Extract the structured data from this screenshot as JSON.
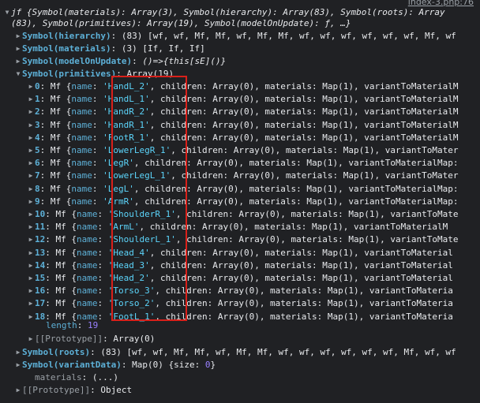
{
  "source_link": "index-3.php:76",
  "header": {
    "line1": "jf {Symbol(materials): Array(3), Symbol(hierarchy): Array(83), Symbol(roots): Array",
    "line2": "(83), Symbol(primitives): Array(19), Symbol(modelOnUpdate): ƒ, …}"
  },
  "hierarchy": {
    "key": "Symbol(hierarchy)",
    "value": "(83) [wf, wf, Mf, Mf, wf, Mf, Mf, wf, wf, wf, wf, wf, wf, Mf, wf"
  },
  "materials": {
    "key": "Symbol(materials)",
    "value": "(3) [If, If, If]"
  },
  "modelOnUpdate": {
    "key": "Symbol(modelOnUpdate)",
    "value": "()=>{this[sE]()}"
  },
  "primitives": {
    "key": "Symbol(primitives)",
    "summary": "Array(19)",
    "items": [
      {
        "idx": "0",
        "cls": "Mf",
        "name": "'HandL_2'",
        "rest": "children: Array(0), materials: Map(1), variantToMaterialM"
      },
      {
        "idx": "1",
        "cls": "Mf",
        "name": "'HandL_1'",
        "rest": "children: Array(0), materials: Map(1), variantToMaterialM"
      },
      {
        "idx": "2",
        "cls": "Mf",
        "name": "'HandR_2'",
        "rest": "children: Array(0), materials: Map(1), variantToMaterialM"
      },
      {
        "idx": "3",
        "cls": "Mf",
        "name": "'HandR_1'",
        "rest": "children: Array(0), materials: Map(1), variantToMaterialM"
      },
      {
        "idx": "4",
        "cls": "Mf",
        "name": "'FootR_1'",
        "rest": "children: Array(0), materials: Map(1), variantToMaterialM"
      },
      {
        "idx": "5",
        "cls": "Mf",
        "name": "'LowerLegR_1'",
        "rest": "children: Array(0), materials: Map(1), variantToMater"
      },
      {
        "idx": "6",
        "cls": "Mf",
        "name": "'LegR'",
        "rest": "children: Array(0), materials: Map(1), variantToMaterialMap:"
      },
      {
        "idx": "7",
        "cls": "Mf",
        "name": "'LowerLegL_1'",
        "rest": "children: Array(0), materials: Map(1), variantToMater"
      },
      {
        "idx": "8",
        "cls": "Mf",
        "name": "'LegL'",
        "rest": "children: Array(0), materials: Map(1), variantToMaterialMap:"
      },
      {
        "idx": "9",
        "cls": "Mf",
        "name": "'ArmR'",
        "rest": "children: Array(0), materials: Map(1), variantToMaterialMap:"
      },
      {
        "idx": "10",
        "cls": "Mf",
        "name": "'ShoulderR_1'",
        "rest": "children: Array(0), materials: Map(1), variantToMate"
      },
      {
        "idx": "11",
        "cls": "Mf",
        "name": "'ArmL'",
        "rest": "children: Array(0), materials: Map(1), variantToMaterialM"
      },
      {
        "idx": "12",
        "cls": "Mf",
        "name": "'ShoulderL_1'",
        "rest": "children: Array(0), materials: Map(1), variantToMate"
      },
      {
        "idx": "13",
        "cls": "Mf",
        "name": "'Head_4'",
        "rest": "children: Array(0), materials: Map(1), variantToMaterial"
      },
      {
        "idx": "14",
        "cls": "Mf",
        "name": "'Head_3'",
        "rest": "children: Array(0), materials: Map(1), variantToMaterial"
      },
      {
        "idx": "15",
        "cls": "Mf",
        "name": "'Head_2'",
        "rest": "children: Array(0), materials: Map(1), variantToMaterial"
      },
      {
        "idx": "16",
        "cls": "Mf",
        "name": "'Torso_3'",
        "rest": "children: Array(0), materials: Map(1), variantToMateria"
      },
      {
        "idx": "17",
        "cls": "Mf",
        "name": "'Torso_2'",
        "rest": "children: Array(0), materials: Map(1), variantToMateria"
      },
      {
        "idx": "18",
        "cls": "Mf",
        "name": "'FootL_1'",
        "rest": "children: Array(0), materials: Map(1), variantToMateria"
      }
    ],
    "length_key": "length",
    "length_value": "19",
    "prototype_key": "[[Prototype]]",
    "prototype_value": "Array(0)"
  },
  "roots": {
    "key": "Symbol(roots)",
    "value": "(83) [wf, wf, Mf, Mf, wf, Mf, Mf, wf, wf, wf, wf, wf, wf, Mf, wf, wf"
  },
  "variantData": {
    "key": "Symbol(variantData)",
    "value_prefix": "Map(0) {size: ",
    "size": "0",
    "value_suffix": "}"
  },
  "materials_getter": {
    "key": "materials",
    "value": "(...)"
  },
  "prototype": {
    "key": "[[Prototype]]",
    "value": "Object"
  },
  "colors": {
    "background": "#202124",
    "symbol_key": "#5db0d7",
    "string": "#5cd5fb",
    "number": "#9980ff",
    "highlight": "#d9201a"
  }
}
